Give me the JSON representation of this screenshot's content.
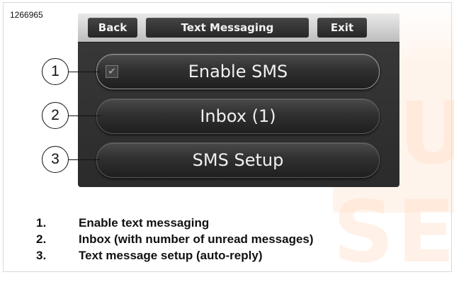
{
  "figure": {
    "id": "1266965"
  },
  "watermark": {
    "text": "AUTO SER"
  },
  "screen": {
    "topbar": {
      "back_label": "Back",
      "title": "Text Messaging",
      "exit_label": "Exit"
    },
    "menu": [
      {
        "label": "Enable SMS",
        "checked": true,
        "check_glyph": "✔"
      },
      {
        "label": "Inbox (1)"
      },
      {
        "label": "SMS Setup"
      }
    ]
  },
  "callouts": [
    "1",
    "2",
    "3"
  ],
  "legend": [
    {
      "num": "1.",
      "text": "Enable text messaging"
    },
    {
      "num": "2.",
      "text": "Inbox (with number of unread messages)"
    },
    {
      "num": "3.",
      "text": "Text message setup (auto-reply)"
    }
  ]
}
